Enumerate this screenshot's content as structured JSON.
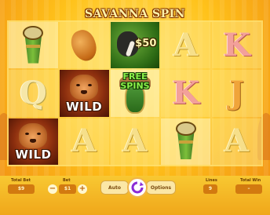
{
  "game": {
    "title": "SAVANNA SPIN"
  },
  "reels": {
    "rows": [
      [
        {
          "symbol": "drum-icon",
          "text": ""
        },
        {
          "symbol": "gourd-icon",
          "text": ""
        },
        {
          "symbol": "gorilla-money",
          "text": "$50"
        },
        {
          "symbol": "letter-a",
          "text": "A"
        },
        {
          "symbol": "letter-k",
          "text": "K"
        }
      ],
      [
        {
          "symbol": "letter-q",
          "text": "Q"
        },
        {
          "symbol": "lion-wild",
          "text": "WILD"
        },
        {
          "symbol": "free-spins-mask",
          "text": "FREE SPINS"
        },
        {
          "symbol": "letter-k",
          "text": "K"
        },
        {
          "symbol": "letter-j",
          "text": "J"
        }
      ],
      [
        {
          "symbol": "lion-wild",
          "text": "WILD"
        },
        {
          "symbol": "letter-a",
          "text": "A"
        },
        {
          "symbol": "letter-a",
          "text": "A"
        },
        {
          "symbol": "drum-icon",
          "text": ""
        },
        {
          "symbol": "letter-a",
          "text": "A"
        }
      ]
    ]
  },
  "controls": {
    "total_bet_label": "Total Bet",
    "total_bet_value": "$9",
    "bet_label": "Bet",
    "bet_value": "$1",
    "minus": "−",
    "plus": "+",
    "auto_label": "Auto",
    "options_label": "Options",
    "lines_label": "Lines",
    "lines_value": "9",
    "total_win_label": "Total Win",
    "total_win_value": "–"
  },
  "colors": {
    "background": "#f3c027",
    "spin_ring": "#8b2bd6"
  }
}
